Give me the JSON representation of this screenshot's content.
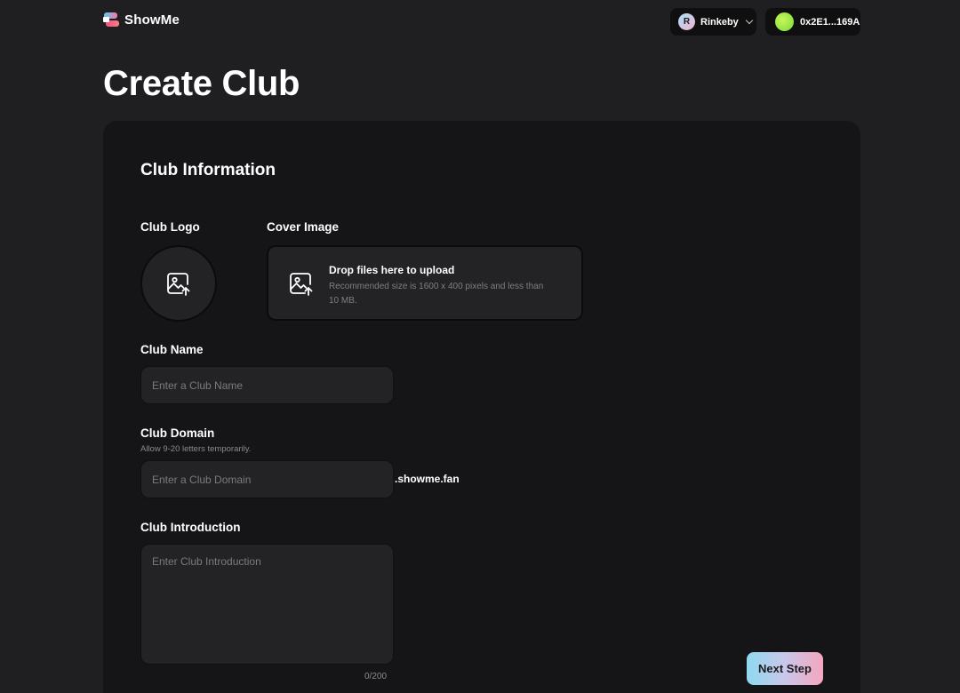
{
  "header": {
    "brand": "ShowMe",
    "network": {
      "avatar_letter": "R",
      "label": "Rinkeby"
    },
    "wallet": {
      "address": "0x2E1...169A",
      "dot_color": "#9be84a"
    }
  },
  "page": {
    "title": "Create Club"
  },
  "form": {
    "section_title": "Club Information",
    "club_logo": {
      "label": "Club Logo"
    },
    "cover_image": {
      "label": "Cover Image",
      "drop_title": "Drop files here to upload",
      "drop_desc": "Recommended size is 1600 x 400 pixels and less than 10 MB."
    },
    "club_name": {
      "label": "Club Name",
      "placeholder": "Enter a Club Name",
      "value": ""
    },
    "club_domain": {
      "label": "Club Domain",
      "hint": "Allow 9-20 letters temporarily.",
      "placeholder": "Enter a Club Domain",
      "value": "",
      "suffix": ".showme.fan"
    },
    "club_introduction": {
      "label": "Club Introduction",
      "placeholder": "Enter Club Introduction",
      "value": "",
      "counter": "0/200"
    },
    "next_button": "Next Step"
  },
  "colors": {
    "background": "#1f1f22",
    "card": "#151517",
    "input": "#232326",
    "accent_gradient": [
      "#8fd9ef",
      "#f5a6bf"
    ]
  },
  "icons": {
    "logo_upload": "image-upload-icon",
    "cover_upload": "image-upload-icon",
    "network_dropdown": "chevron-down-icon"
  }
}
